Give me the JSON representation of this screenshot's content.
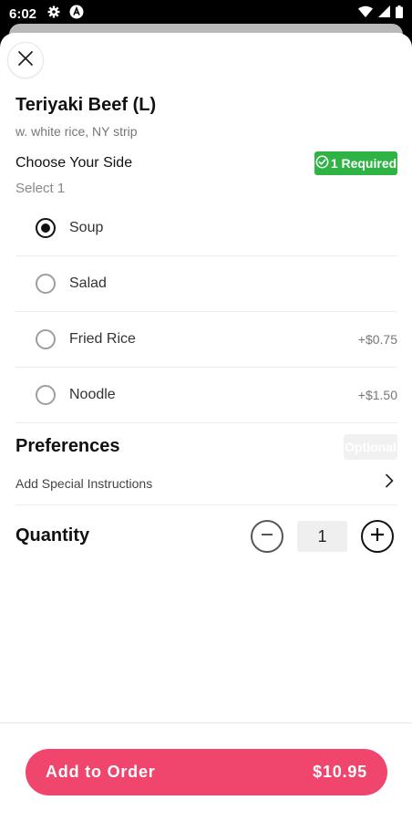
{
  "status_bar": {
    "time": "6:02",
    "left_icons": [
      "gear-icon",
      "app-a-icon"
    ],
    "right_icons": [
      "wifi-icon",
      "signal-icon",
      "battery-icon"
    ]
  },
  "item": {
    "title": "Teriyaki Beef (L)",
    "description": "w. white rice, NY strip"
  },
  "side_section": {
    "title": "Choose Your Side",
    "subtitle": "Select 1",
    "badge": "1 Required",
    "badge_color": "#2fb344",
    "options": [
      {
        "label": "Soup",
        "price": "",
        "selected": true
      },
      {
        "label": "Salad",
        "price": "",
        "selected": false
      },
      {
        "label": "Fried Rice",
        "price": "+$0.75",
        "selected": false
      },
      {
        "label": "Noodle",
        "price": "+$1.50",
        "selected": false
      }
    ]
  },
  "preferences": {
    "title": "Preferences",
    "badge": "Optional",
    "instructions_label": "Add Special Instructions"
  },
  "quantity": {
    "label": "Quantity",
    "value": "1"
  },
  "footer": {
    "button_label": "Add to Order",
    "button_price": "$10.95",
    "button_color": "#f0466e"
  }
}
